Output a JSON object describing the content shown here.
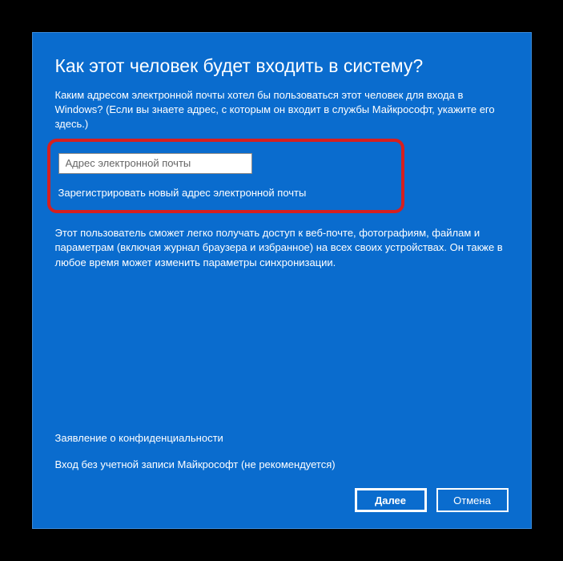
{
  "dialog": {
    "title": "Как этот человек будет входить в систему?",
    "description": "Каким адресом электронной почты хотел бы пользоваться этот человек для входа в Windows? (Если вы знаете адрес, с которым он входит в службы Майкрософт, укажите его здесь.)",
    "email_placeholder": "Адрес электронной почты",
    "register_link": "Зарегистрировать новый адрес электронной почты",
    "info_text": "Этот пользователь сможет легко получать доступ к веб-почте, фотографиям, файлам и параметрам (включая журнал браузера и избранное) на всех своих устройствах. Он также в любое время может изменить параметры синхронизации.",
    "privacy_link": "Заявление о конфиденциальности",
    "no_account_link": "Вход без учетной записи Майкрософт (не рекомендуется)",
    "next_button": "Далее",
    "cancel_button": "Отмена"
  }
}
